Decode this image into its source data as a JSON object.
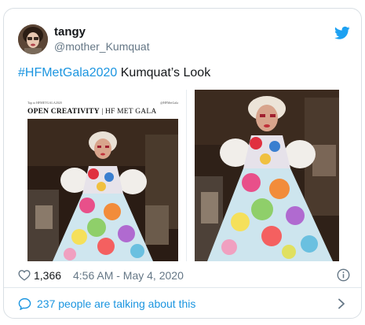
{
  "user": {
    "name": "tangy",
    "handle": "@mother_Kumquat",
    "avatar_icon": "avatar-photo",
    "brand_icon": "twitter-bird-icon"
  },
  "tweet": {
    "hashtag": "#HFMetGala2020",
    "text": " Kumquat’s Look"
  },
  "media": {
    "magazine_header_left": "Tap to HFMETGALA2020",
    "magazine_header_right": "@HFMetGala",
    "magazine_title_bold": "OPEN CREATIVITY",
    "magazine_title_rest": " | HF MET GALA"
  },
  "footer": {
    "likes": "1,366",
    "timestamp": "4:56 AM - May 4, 2020",
    "like_icon": "heart-icon",
    "info_icon": "info-icon"
  },
  "conversation": {
    "label": "237 people are talking about this",
    "icon": "speech-bubble-icon",
    "chevron": "chevron-right-icon"
  },
  "colors": {
    "link": "#1b95e0",
    "secondary": "#657786",
    "border": "#d9dfe4",
    "text": "#14171a"
  }
}
